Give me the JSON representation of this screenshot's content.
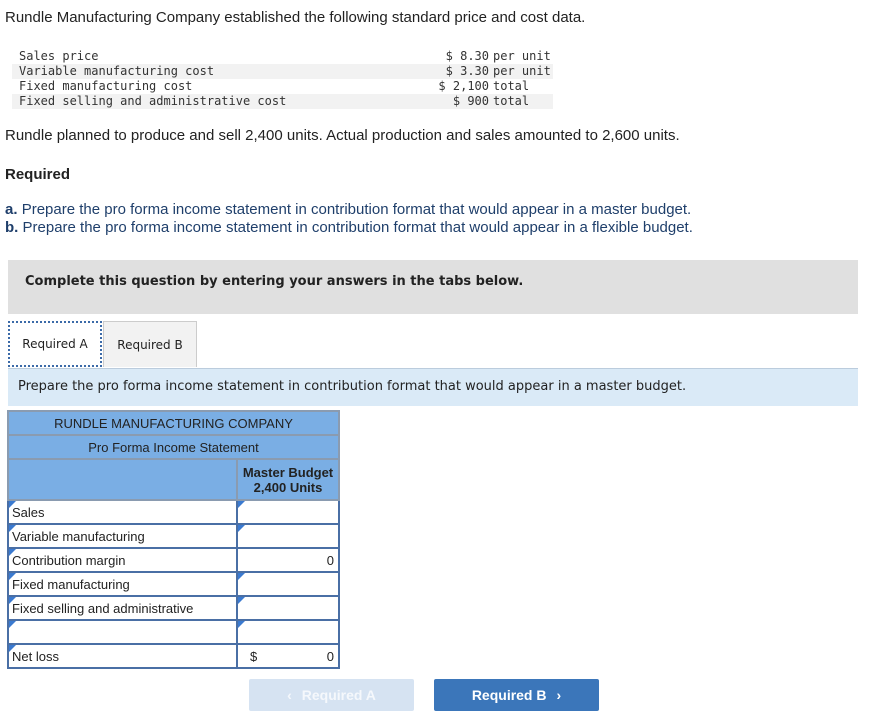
{
  "intro": "Rundle Manufacturing Company established the following standard price and cost data.",
  "cost_data": [
    {
      "label": "Sales price",
      "amount": "$ 8.30",
      "unit": "per unit"
    },
    {
      "label": "Variable manufacturing cost",
      "amount": "$ 3.30",
      "unit": "per unit"
    },
    {
      "label": "Fixed manufacturing cost",
      "amount": "$ 2,100",
      "unit": "total"
    },
    {
      "label": "Fixed selling and administrative cost",
      "amount": "$ 900",
      "unit": "total"
    }
  ],
  "plan_text": "Rundle planned to produce and sell 2,400 units. Actual production and sales amounted to 2,600 units.",
  "required_heading": "Required",
  "parts": [
    {
      "letter": "a.",
      "text": "Prepare the pro forma income statement in contribution format that would appear in a master budget."
    },
    {
      "letter": "b.",
      "text": "Prepare the pro forma income statement in contribution format that would appear in a flexible budget."
    }
  ],
  "complete_banner": "Complete this question by entering your answers in the tabs below.",
  "tabs": [
    {
      "label": "Required A",
      "active": true
    },
    {
      "label": "Required B",
      "active": false
    }
  ],
  "instruction": "Prepare the pro forma income statement in contribution format that would appear in a master budget.",
  "statement": {
    "company": "RUNDLE MANUFACTURING COMPANY",
    "title": "Pro Forma Income Statement",
    "column_header_1": "Master Budget",
    "column_header_2": "2,400 Units",
    "rows": [
      {
        "label": "Sales",
        "value": ""
      },
      {
        "label": "Variable manufacturing",
        "value": ""
      },
      {
        "label": "Contribution margin",
        "value": "0"
      },
      {
        "label": "Fixed manufacturing",
        "value": ""
      },
      {
        "label": "Fixed selling and administrative",
        "value": ""
      },
      {
        "label": "",
        "value": ""
      },
      {
        "label": "Net loss",
        "currency": "$",
        "value": "0"
      }
    ]
  },
  "nav": {
    "prev_label": "Required A",
    "next_label": "Required B",
    "prev_icon": "‹",
    "next_icon": "›"
  }
}
